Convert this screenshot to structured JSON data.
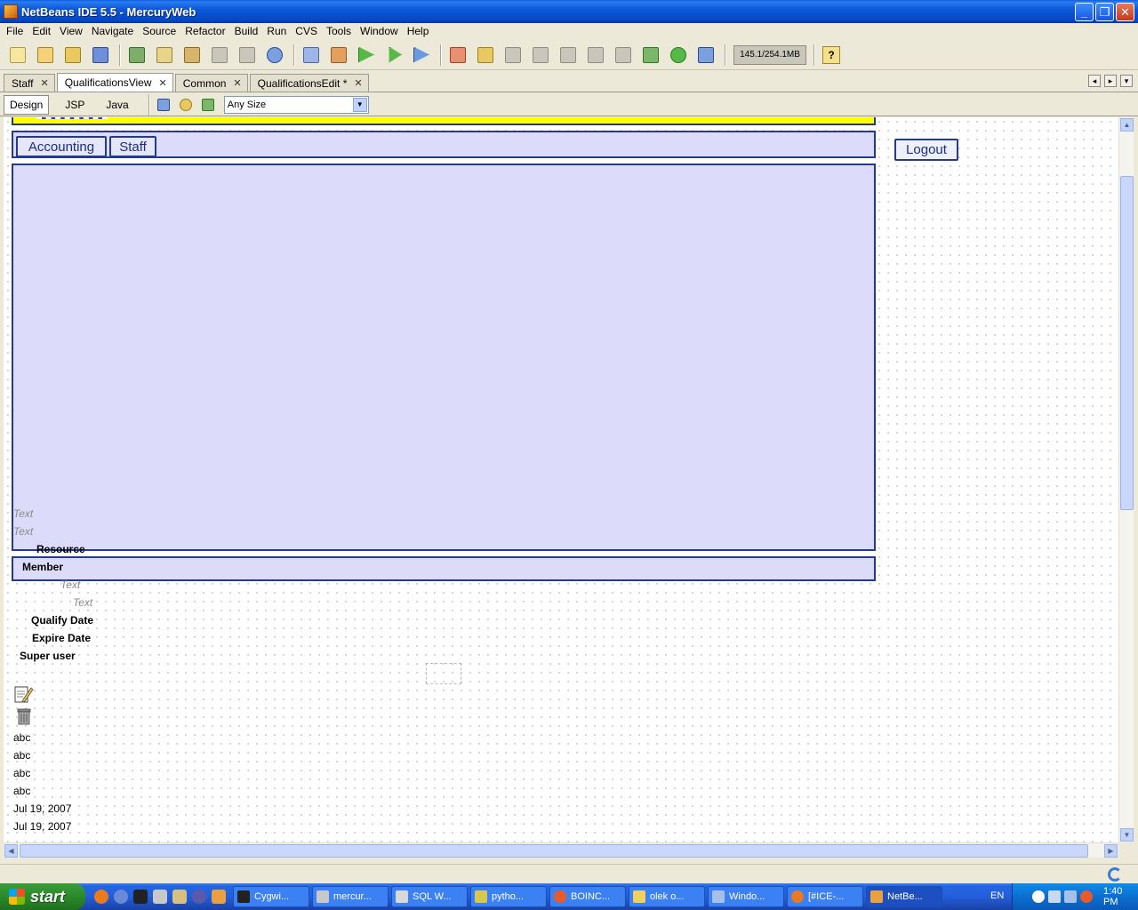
{
  "window": {
    "title": "NetBeans IDE 5.5 - MercuryWeb"
  },
  "menu": [
    "File",
    "Edit",
    "View",
    "Navigate",
    "Source",
    "Refactor",
    "Build",
    "Run",
    "CVS",
    "Tools",
    "Window",
    "Help"
  ],
  "toolbar": {
    "memory": "145.1/254.1MB",
    "help": "?"
  },
  "tabs": [
    {
      "label": "Staff",
      "active": false
    },
    {
      "label": "QualificationsView",
      "active": true
    },
    {
      "label": "Common",
      "active": false
    },
    {
      "label": "QualificationsEdit *",
      "active": false
    }
  ],
  "designbar": {
    "views": [
      "Design",
      "JSP",
      "Java"
    ],
    "size": "Any Size"
  },
  "page": {
    "nav_buttons": [
      "Accounting",
      "Staff"
    ],
    "logout": "Logout",
    "placeholders": [
      "Text",
      "Text",
      "Text",
      "Text"
    ],
    "labels": {
      "resource": "Resource",
      "member": "Member",
      "qualify_date": "Qualify Date",
      "expire_date": "Expire Date",
      "super_user": "Super user"
    },
    "values": [
      "abc",
      "abc",
      "abc",
      "abc",
      "Jul 19, 2007",
      "Jul 19, 2007"
    ]
  },
  "taskbar": {
    "start": "start",
    "tasks": [
      "Cygwi...",
      "mercur...",
      "SQL W...",
      "pytho...",
      "BOINC...",
      "olek o...",
      "Windo...",
      "[#ICE-...",
      "NetBe..."
    ],
    "lang": "EN",
    "clock": "1:40 PM"
  }
}
